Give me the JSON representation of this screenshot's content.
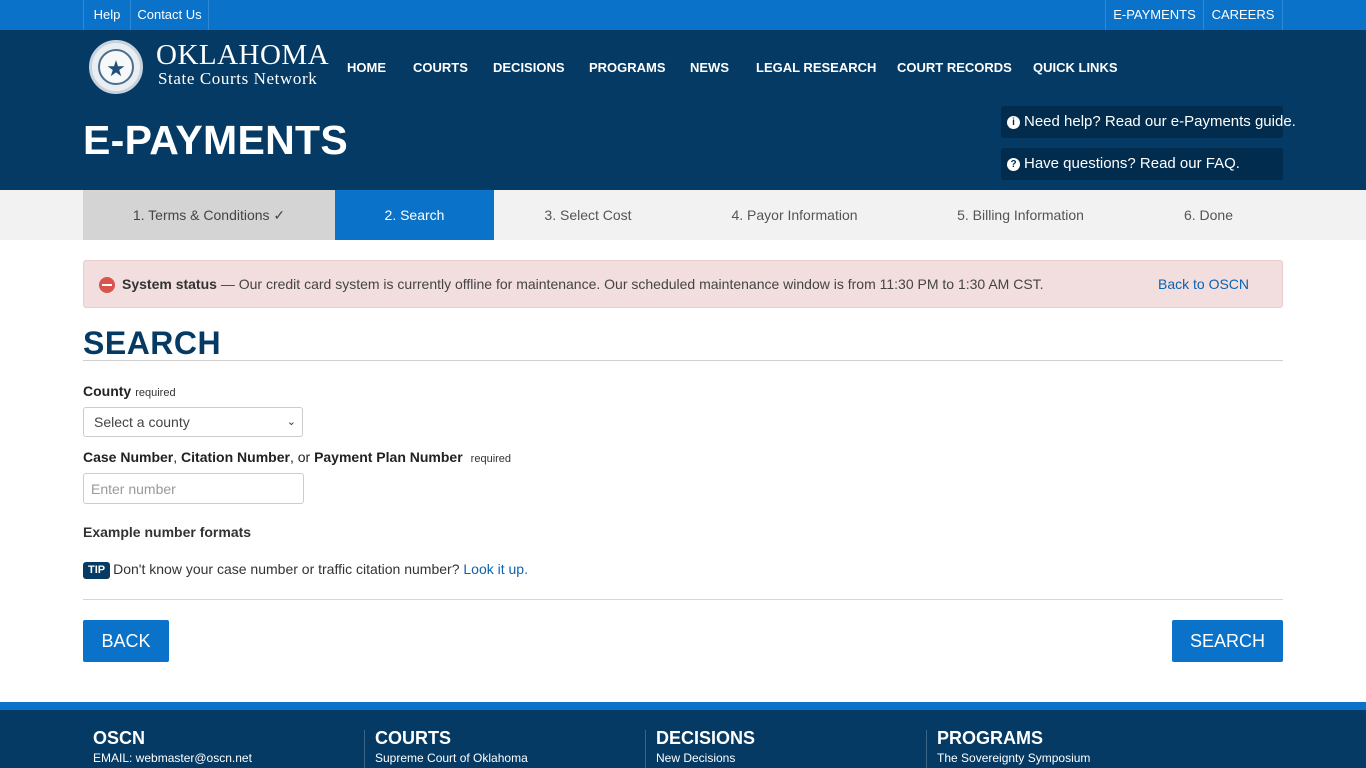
{
  "topbar": {
    "left": [
      "Help",
      "Contact Us"
    ],
    "right": [
      "E-PAYMENTS",
      "CAREERS"
    ]
  },
  "brand": {
    "line1": "OKLAHOMA",
    "line2": "State Courts Network"
  },
  "nav": [
    "HOME",
    "COURTS",
    "DECISIONS",
    "PROGRAMS",
    "NEWS",
    "LEGAL RESEARCH",
    "COURT RECORDS",
    "QUICK LINKS"
  ],
  "page_title": "E-PAYMENTS",
  "help_links": {
    "guide": "Need help? Read our e-Payments guide.",
    "faq": "Have questions? Read our FAQ."
  },
  "steps": [
    {
      "label": "1. Terms & Conditions ✓",
      "state": "done"
    },
    {
      "label": "2. Search",
      "state": "active"
    },
    {
      "label": "3. Select Cost",
      "state": "todo"
    },
    {
      "label": "4. Payor Information",
      "state": "todo"
    },
    {
      "label": "5. Billing Information",
      "state": "todo"
    },
    {
      "label": "6. Done",
      "state": "todo"
    }
  ],
  "alert": {
    "title": "System status",
    "message": " — Our credit card system is currently offline for maintenance. Our scheduled maintenance window is from 11:30 PM to 1:30 AM CST.",
    "back_link": "Back to OSCN"
  },
  "section_title": "SEARCH",
  "form": {
    "county_label": "County",
    "required": "required",
    "county_placeholder": "Select a county",
    "case_label_1": "Case Number",
    "case_sep_1": ", ",
    "case_label_2": "Citation Number",
    "case_sep_2": ", or ",
    "case_label_3": "Payment Plan Number",
    "number_placeholder": "Enter number",
    "example_formats": "Example number formats",
    "tip_badge": "TIP",
    "tip_text": "Don't know your case number or traffic citation number? ",
    "tip_link": "Look it up."
  },
  "buttons": {
    "back": "BACK",
    "search": "SEARCH"
  },
  "footer": [
    {
      "heading": "OSCN",
      "sub": "EMAIL: webmaster@oscn.net"
    },
    {
      "heading": "COURTS",
      "sub": "Supreme Court of Oklahoma"
    },
    {
      "heading": "DECISIONS",
      "sub": "New Decisions"
    },
    {
      "heading": "PROGRAMS",
      "sub": "The Sovereignty Symposium"
    }
  ],
  "colors": {
    "top_bar": "#0b72c9",
    "header": "#043a63",
    "active_step": "#0b72c9",
    "alert_bg": "#f2dede",
    "link": "#0b62b0"
  }
}
